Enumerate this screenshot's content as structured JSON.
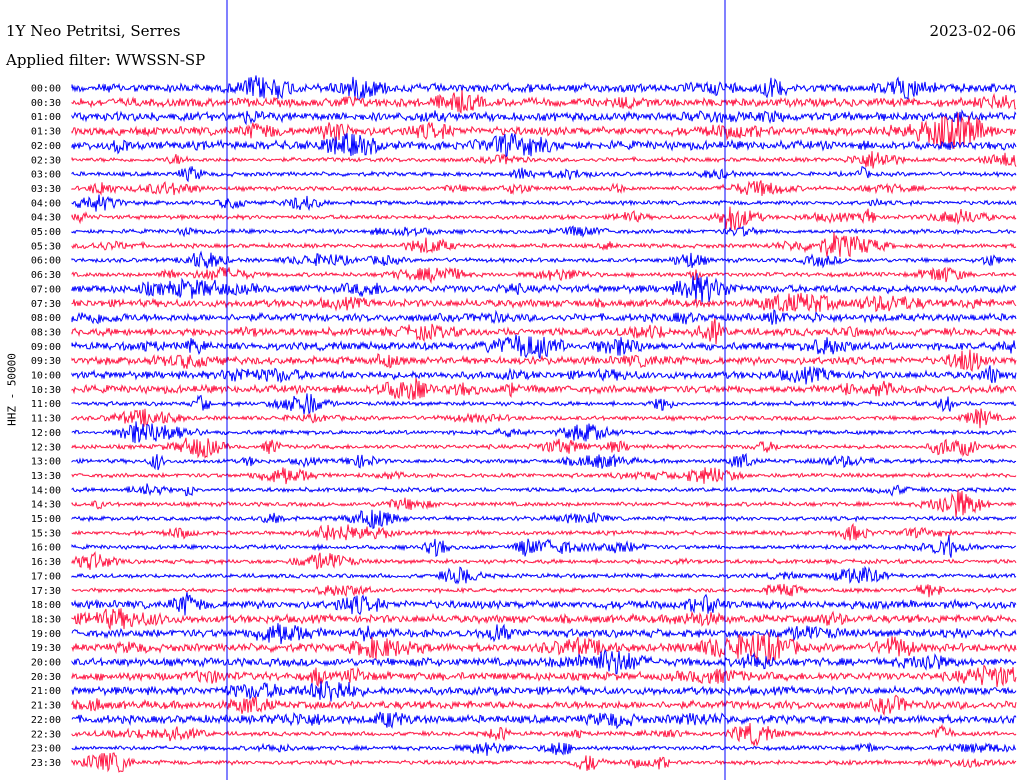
{
  "header": {
    "station": "1Y Neo Petritsi, Serres",
    "filter": "Applied filter: WWSSN-SP",
    "date": "2023-02-06"
  },
  "channel_label": "HHZ - 50000",
  "colors": {
    "odd_trace": "#0000ff",
    "even_trace": "#ff1744",
    "background": "#ffffff"
  },
  "time_labels": [
    "00:00",
    "00:30",
    "01:00",
    "01:30",
    "02:00",
    "02:30",
    "03:00",
    "03:30",
    "04:00",
    "04:30",
    "05:00",
    "05:30",
    "06:00",
    "06:30",
    "07:00",
    "07:30",
    "08:00",
    "08:30",
    "09:00",
    "09:30",
    "10:00",
    "10:30",
    "11:00",
    "11:30",
    "12:00",
    "12:30",
    "13:00",
    "13:30",
    "14:00",
    "14:30",
    "15:00",
    "15:30",
    "16:00",
    "16:30",
    "17:00",
    "17:30",
    "18:00",
    "18:30",
    "19:00",
    "19:30",
    "20:00",
    "20:30",
    "21:00",
    "21:30",
    "22:00",
    "22:30",
    "23:00",
    "23:30"
  ]
}
